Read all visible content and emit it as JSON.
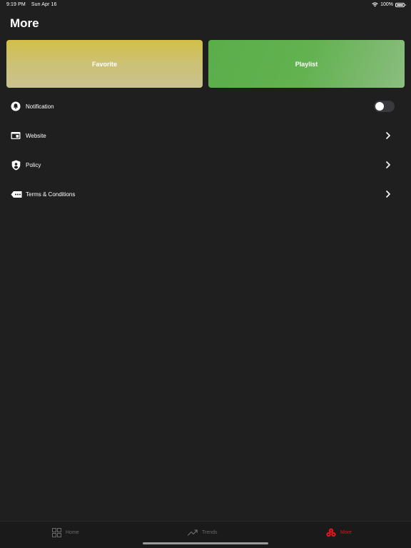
{
  "status_bar": {
    "time": "9:19 PM",
    "date": "Sun Apr 16",
    "battery": "100%",
    "wifi_icon": "wifi-icon",
    "battery_icon": "battery-icon"
  },
  "page": {
    "title": "More"
  },
  "cards": {
    "favorite": {
      "label": "Favorite"
    },
    "playlist": {
      "label": "Playlist"
    }
  },
  "menu": {
    "items": [
      {
        "label": "Notification",
        "icon": "bell-icon",
        "control": "toggle",
        "toggle_on": false
      },
      {
        "label": "Website",
        "icon": "browser-window-icon",
        "control": "chevron"
      },
      {
        "label": "Policy",
        "icon": "shield-user-icon",
        "control": "chevron"
      },
      {
        "label": "Terms & Conditions",
        "icon": "tag-dots-icon",
        "control": "chevron"
      }
    ]
  },
  "tab_bar": {
    "tabs": [
      {
        "label": "Home",
        "icon": "grid-icon",
        "active": false
      },
      {
        "label": "Trends",
        "icon": "trend-up-icon",
        "active": false
      },
      {
        "label": "More",
        "icon": "more-cluster-icon",
        "active": true
      }
    ]
  },
  "colors": {
    "background": "#1f1f1f",
    "accent": "#e0141d",
    "favorite_card": "#cdc172",
    "playlist_card": "#62b250",
    "inactive_tab": "#6b6b6b"
  }
}
